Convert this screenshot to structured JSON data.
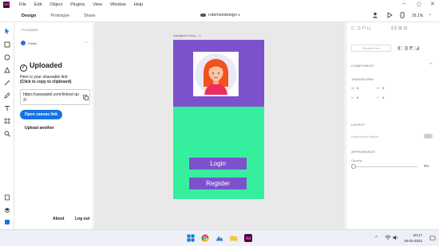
{
  "app": {
    "logo": "Xd",
    "colors": {
      "accent": "#1473e6",
      "purple": "#7c52cc",
      "green": "#36ef9e"
    }
  },
  "menu": [
    "File",
    "Edit",
    "Object",
    "Plugins",
    "View",
    "Window",
    "Help"
  ],
  "modes": [
    "Design",
    "Prototype",
    "Share"
  ],
  "document": {
    "name": "rulemsndesign"
  },
  "zoom": "26.1%",
  "tools": [
    "select-icon",
    "rectangle-icon",
    "ellipse-icon",
    "triangle-icon",
    "line-icon",
    "pen-icon",
    "text-icon",
    "artboard-icon",
    "zoom-icon",
    "documents-icon",
    "layers-icon",
    "plugins-icon"
  ],
  "plugin_panel": {
    "back": "‹ PLUGINS",
    "plugin_name": "Pastel",
    "heading": "Uploaded",
    "hint_line1": "Here is your shareable link:",
    "hint_line2": "(Click to copy to clipboard)",
    "url": "https://usepastel.com/link/yd qu2/",
    "open_button": "Open canvas link",
    "upload_button": "Upload another",
    "about": "About",
    "logout": "Log out"
  },
  "canvas": {
    "artboard_label": "Instagram Story – 1",
    "login_label": "Login",
    "register_label": "Register"
  },
  "properties": {
    "repeat_grid": "Repeat Grid",
    "component": "COMPONENT",
    "transform": "TRANSFORM",
    "w_label": "W",
    "w_value": "0",
    "h_label": "H",
    "h_value": "0",
    "x_label": "X",
    "x_value": "0",
    "y_label": "Y",
    "y_value": "0",
    "layout": "LAYOUT",
    "responsive_resize": "Responsive Resize",
    "appearance": "APPEARANCE",
    "opacity": "Opacity",
    "opacity_value": "0%"
  },
  "taskbar": {
    "time": "20:17",
    "date": "18-02-2022"
  }
}
